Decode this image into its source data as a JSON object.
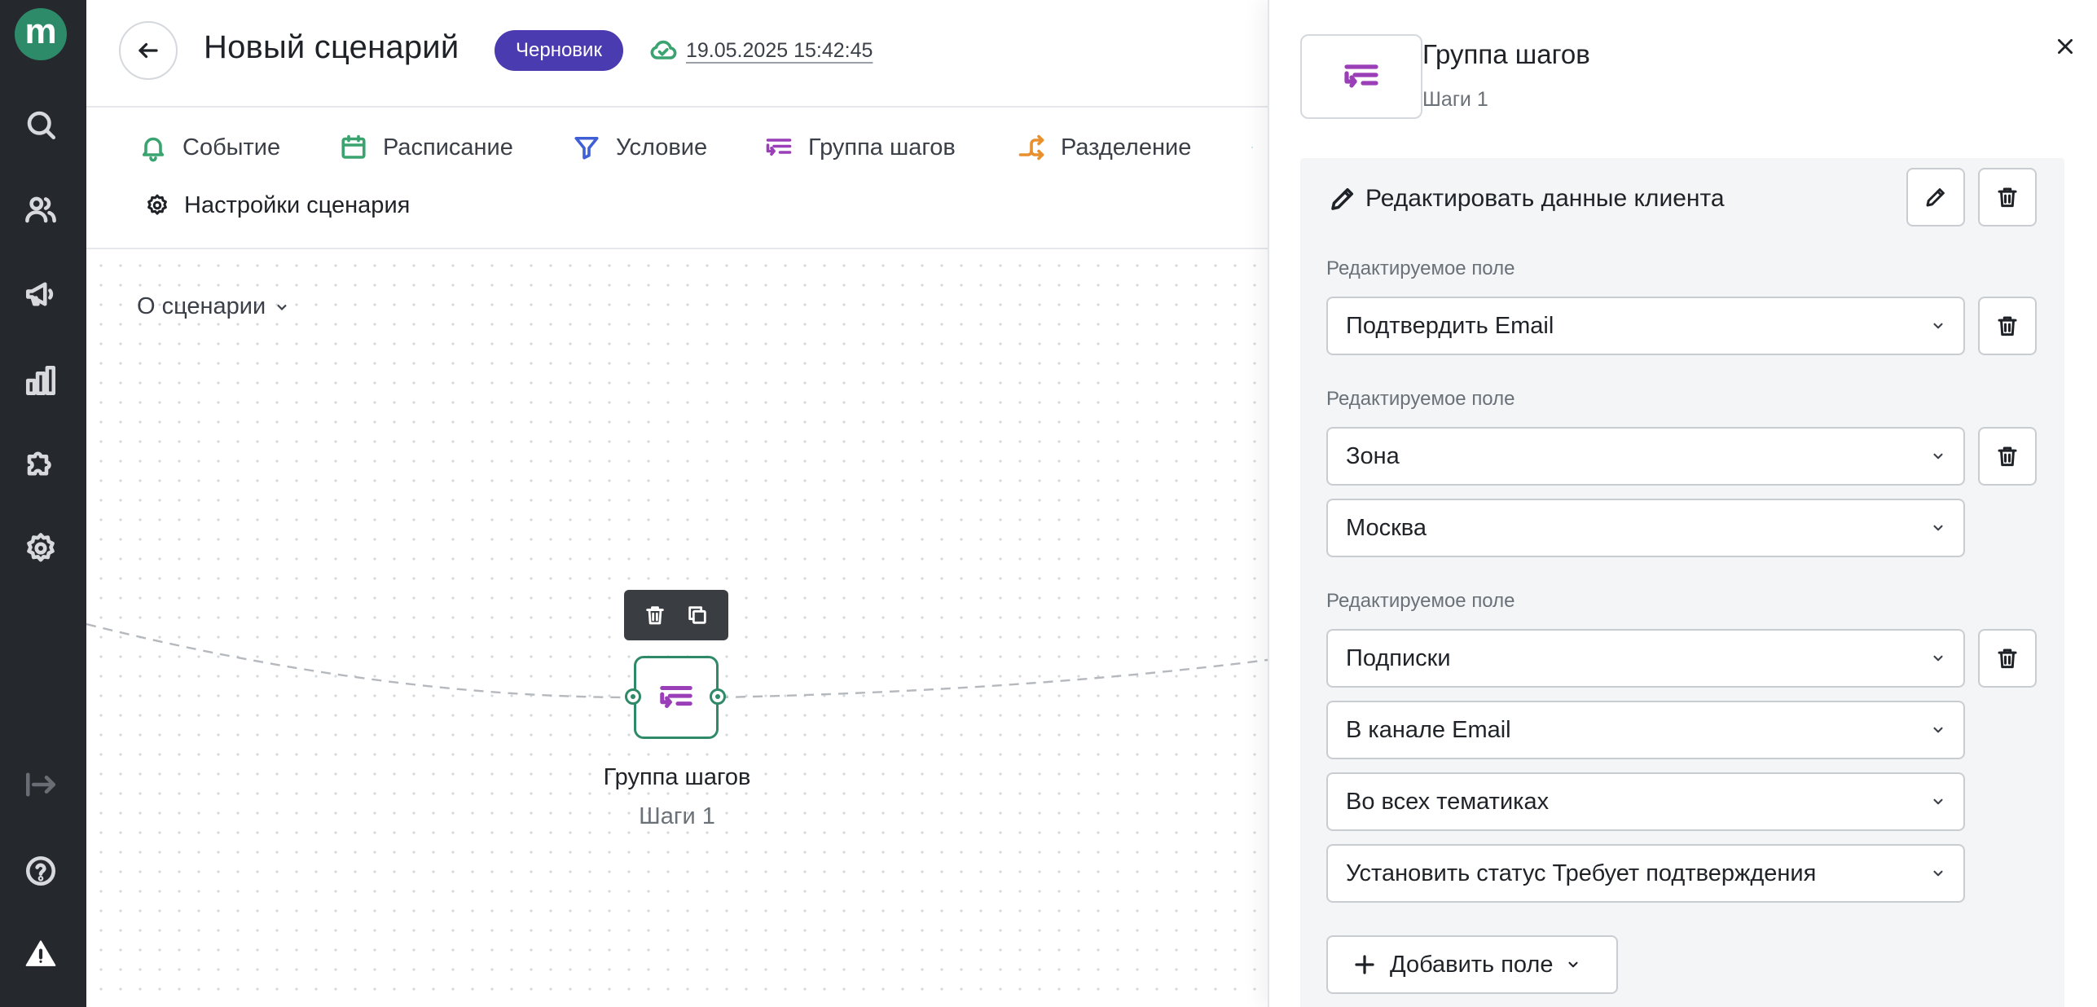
{
  "app": {
    "logo_letter": "m",
    "accent_color": "#2e8b6a",
    "rail_icons": [
      "search-icon",
      "users-icon",
      "megaphone-icon",
      "analytics-icon",
      "puzzle-icon",
      "gear-icon",
      "collapse-icon",
      "help-icon",
      "warning-icon"
    ]
  },
  "header": {
    "title": "Новый сценарий",
    "status_badge": "Черновик",
    "saved_at": "19.05.2025 15:42:45"
  },
  "toolbar": {
    "items": [
      {
        "label": "Событие",
        "icon": "bell-icon",
        "color": "#3aa36f"
      },
      {
        "label": "Расписание",
        "icon": "calendar-icon",
        "color": "#3aa36f"
      },
      {
        "label": "Условие",
        "icon": "filter-icon",
        "color": "#3f5fd6"
      },
      {
        "label": "Группа шагов",
        "icon": "step-group-icon",
        "color": "#9a3fb8"
      },
      {
        "label": "Разделение",
        "icon": "split-icon",
        "color": "#e8902e"
      }
    ],
    "settings_label": "Настройки сценария"
  },
  "canvas": {
    "about_label": "О сценарии",
    "node": {
      "title": "Группа шагов",
      "subtitle": "Шаги 1"
    }
  },
  "panel": {
    "title": "Группа шагов",
    "subtitle": "Шаги 1",
    "step_title": "Редактировать данные клиента",
    "field_label": "Редактируемое поле",
    "fields": [
      {
        "value": "Подтвердить Email"
      },
      {
        "value": "Зона",
        "sub": [
          "Москва"
        ]
      },
      {
        "value": "Подписки",
        "sub": [
          "В канале Email",
          "Во всех тематиках",
          "Установить статус Требует подтверждения"
        ]
      }
    ],
    "add_field_label": "Добавить поле"
  }
}
